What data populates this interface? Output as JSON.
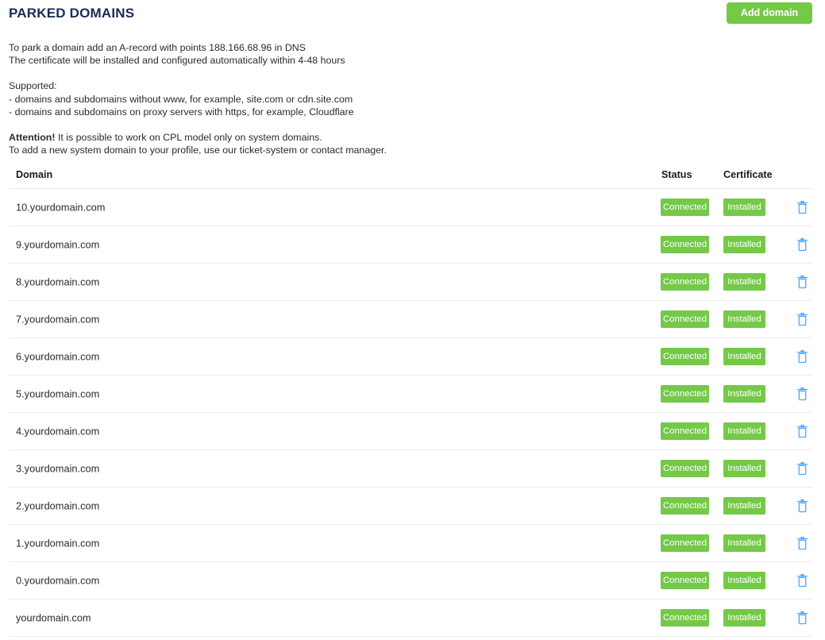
{
  "header": {
    "title": "PARKED DOMAINS",
    "add_domain_label": "Add domain"
  },
  "intro": {
    "line1": "To park a domain add an A-record with points 188.166.68.96 in DNS",
    "line2": "The certificate will be installed and configured automatically within 4-48 hours",
    "supported_label": "Supported:",
    "supported_item1": "- domains and subdomains without www, for example, site.com or cdn.site.com",
    "supported_item2": "- domains and subdomains on proxy servers with https, for example, Cloudflare",
    "attention_label": "Attention!",
    "attention_text": " It is possible to work on CPL model only on system domains.",
    "attention_line2": "To add a new system domain to your profile, use our ticket-system or contact manager."
  },
  "table": {
    "columns": {
      "domain": "Domain",
      "status": "Status",
      "certificate": "Certificate"
    },
    "delete_icon": "trash-icon",
    "rows": [
      {
        "domain": "10.yourdomain.com",
        "status": "Connected",
        "certificate": "Installed"
      },
      {
        "domain": "9.yourdomain.com",
        "status": "Connected",
        "certificate": "Installed"
      },
      {
        "domain": "8.yourdomain.com",
        "status": "Connected",
        "certificate": "Installed"
      },
      {
        "domain": "7.yourdomain.com",
        "status": "Connected",
        "certificate": "Installed"
      },
      {
        "domain": "6.yourdomain.com",
        "status": "Connected",
        "certificate": "Installed"
      },
      {
        "domain": "5.yourdomain.com",
        "status": "Connected",
        "certificate": "Installed"
      },
      {
        "domain": "4.yourdomain.com",
        "status": "Connected",
        "certificate": "Installed"
      },
      {
        "domain": "3.yourdomain.com",
        "status": "Connected",
        "certificate": "Installed"
      },
      {
        "domain": "2.yourdomain.com",
        "status": "Connected",
        "certificate": "Installed"
      },
      {
        "domain": "1.yourdomain.com",
        "status": "Connected",
        "certificate": "Installed"
      },
      {
        "domain": "0.yourdomain.com",
        "status": "Connected",
        "certificate": "Installed"
      },
      {
        "domain": "yourdomain.com",
        "status": "Connected",
        "certificate": "Installed"
      }
    ]
  },
  "colors": {
    "title": "#1c2b57",
    "accent_green": "#74c947",
    "trash_blue": "#4da6f5",
    "row_divider": "#ededed"
  }
}
